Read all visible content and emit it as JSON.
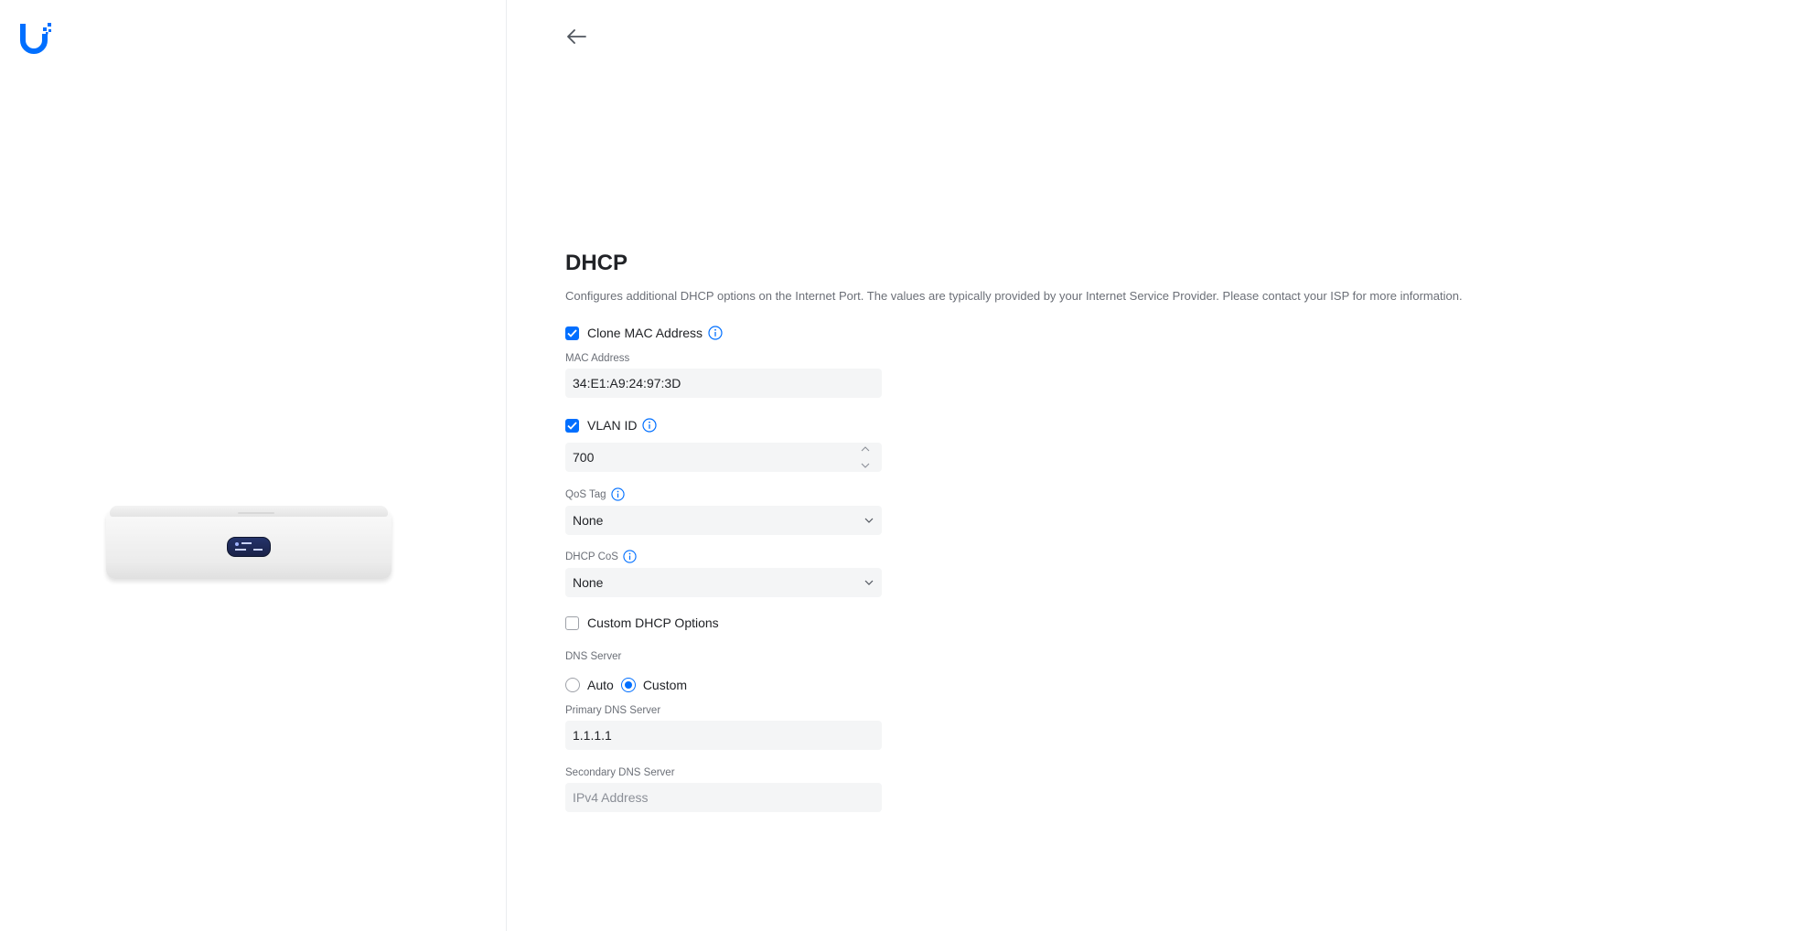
{
  "app": {
    "logo_icon": "ubiquiti-u-logo",
    "accent": "#006fff"
  },
  "nav": {
    "back_icon": "arrow-left-icon"
  },
  "device": {
    "image": "unifi-cloud-gateway-device"
  },
  "page": {
    "title": "DHCP",
    "description": "Configures additional DHCP options on the Internet Port. The values are typically provided by your Internet Service Provider. Please contact your ISP for more information."
  },
  "form": {
    "clone_mac": {
      "label": "Clone MAC Address",
      "checked": true
    },
    "mac_address": {
      "label": "MAC Address",
      "value": "34:E1:A9:24:97:3D"
    },
    "vlan": {
      "label": "VLAN ID",
      "checked": true,
      "value": "700"
    },
    "qos_tag": {
      "label": "QoS Tag",
      "value": "None"
    },
    "dhcp_cos": {
      "label": "DHCP CoS",
      "value": "None"
    },
    "custom_dhcp": {
      "label": "Custom DHCP Options",
      "checked": false
    },
    "dns_server": {
      "label": "DNS Server",
      "options": [
        {
          "label": "Auto",
          "selected": false
        },
        {
          "label": "Custom",
          "selected": true
        }
      ]
    },
    "primary_dns": {
      "label": "Primary DNS Server",
      "value": "1.1.1.1"
    },
    "secondary_dns": {
      "label": "Secondary DNS Server",
      "placeholder": "IPv4 Address",
      "value": ""
    }
  }
}
